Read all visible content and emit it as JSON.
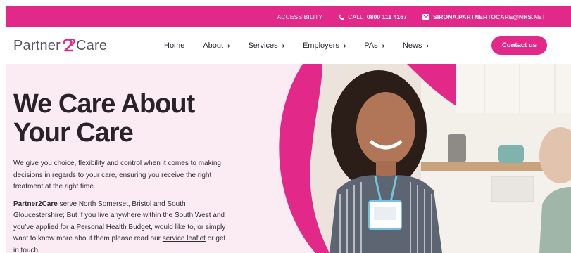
{
  "topbar": {
    "accessibility": "ACCESSIBILITY",
    "call_prefix": "CALL",
    "call_number": "0800 111 4167",
    "email": "SIRONA.PARTNERTOCARE@NHS.NET"
  },
  "header": {
    "logo_left": "Partner",
    "logo_num": "2",
    "logo_right": "Care",
    "nav": [
      {
        "label": "Home",
        "has_menu": false
      },
      {
        "label": "About",
        "has_menu": true
      },
      {
        "label": "Services",
        "has_menu": true
      },
      {
        "label": "Employers",
        "has_menu": true
      },
      {
        "label": "PAs",
        "has_menu": true
      },
      {
        "label": "News",
        "has_menu": true
      }
    ],
    "chevron": "›",
    "contact": "Contact us"
  },
  "hero": {
    "title_line1": "We Care About",
    "title_line2": "Your Care",
    "para1": "We give you choice, flexibility and control when it comes to making decisions in regards to your care, ensuring you receive the right treatment at the right time.",
    "para2_bold": "Partner2Care",
    "para2_rest": " serve North Somerset, Bristol and South Gloucestershire; But if you live anywhere within the South West and you’ve applied for a Personal Health Budget, would like to, or simply want to know more about them please read our ",
    "para2_link": "service leaflet",
    "para2_end": " or get in touch."
  },
  "colors": {
    "brand_pink": "#e2298a",
    "hero_bg": "#fbecf4",
    "heading": "#2a2129"
  }
}
